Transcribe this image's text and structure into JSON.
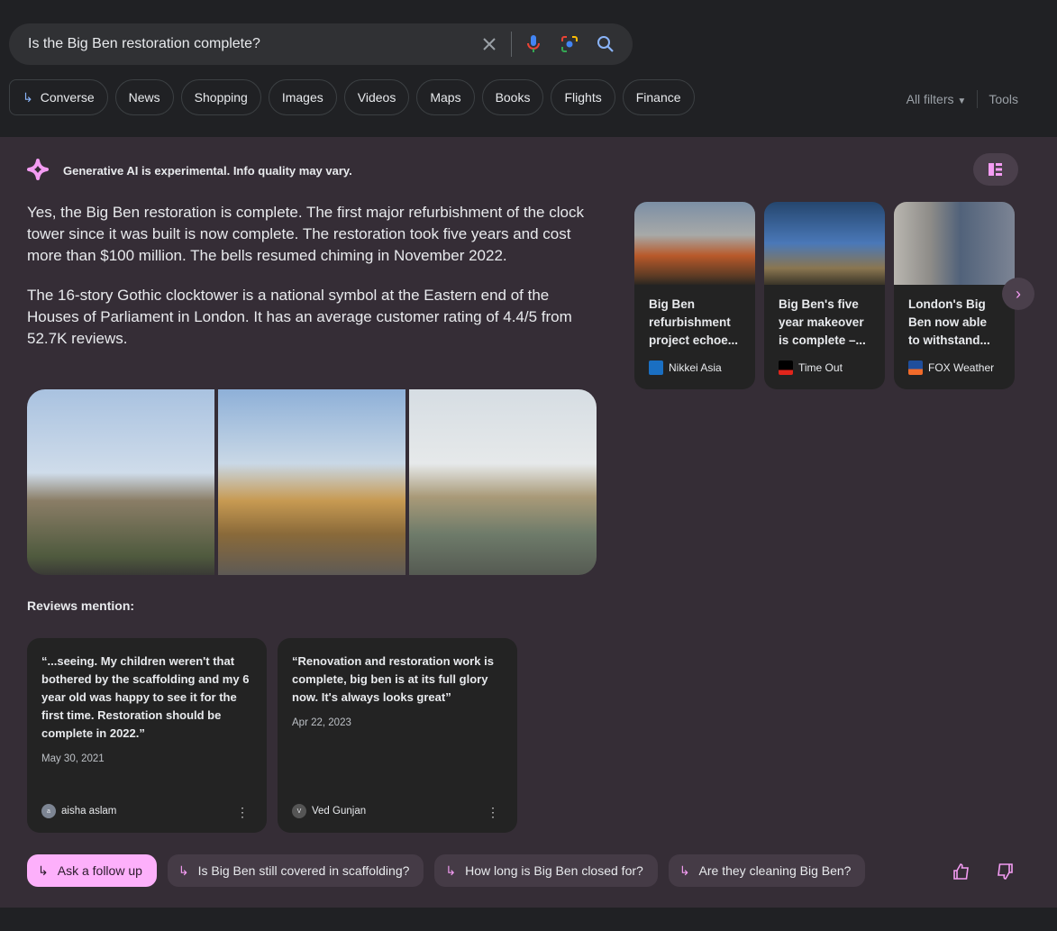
{
  "search": {
    "query": "Is the Big Ben restoration complete?",
    "icons": [
      "close-icon",
      "mic-icon",
      "lens-icon",
      "search-icon"
    ]
  },
  "chips": [
    "Converse",
    "News",
    "Shopping",
    "Images",
    "Videos",
    "Maps",
    "Books",
    "Flights",
    "Finance"
  ],
  "tools": {
    "all_filters": "All filters",
    "tools": "Tools"
  },
  "ai": {
    "notice": "Generative AI is experimental. Info quality may vary.",
    "accent": "#f49cf3",
    "paragraphs": [
      "Yes, the Big Ben restoration is complete. The first major refurbishment of the clock tower since it was built is now complete. The restoration took five years and cost more than $100 million. The bells resumed chiming in November 2022.",
      "The 16-story Gothic clocktower is a national symbol at the Eastern end of the Houses of Parliament in London. It has an average customer rating of 4.4/5 from 52.7K reviews."
    ],
    "news": [
      {
        "title": "Big Ben refurbishment project echoe...",
        "source": "Nikkei Asia"
      },
      {
        "title": "Big Ben's five year makeover is complete –...",
        "source": "Time Out"
      },
      {
        "title": "London's Big Ben now able to withstand...",
        "source": "FOX Weather"
      }
    ],
    "reviews_heading": "Reviews mention:",
    "reviews": [
      {
        "text": "“...seeing. My children weren't that bothered by the scaffolding and my 6 year old was happy to see it for the first time. Restoration should be complete in 2022.”",
        "date": "May 30, 2021",
        "author": "aisha aslam",
        "initial": "a"
      },
      {
        "text": "“Renovation and restoration work is complete, big ben is at its full glory now. It's always looks great”",
        "date": "Apr 22, 2023",
        "author": "Ved Gunjan",
        "initial": "V"
      }
    ],
    "followups": [
      "Ask a follow up",
      "Is Big Ben still covered in scaffolding?",
      "How long is Big Ben closed for?",
      "Are they cleaning Big Ben?"
    ]
  }
}
